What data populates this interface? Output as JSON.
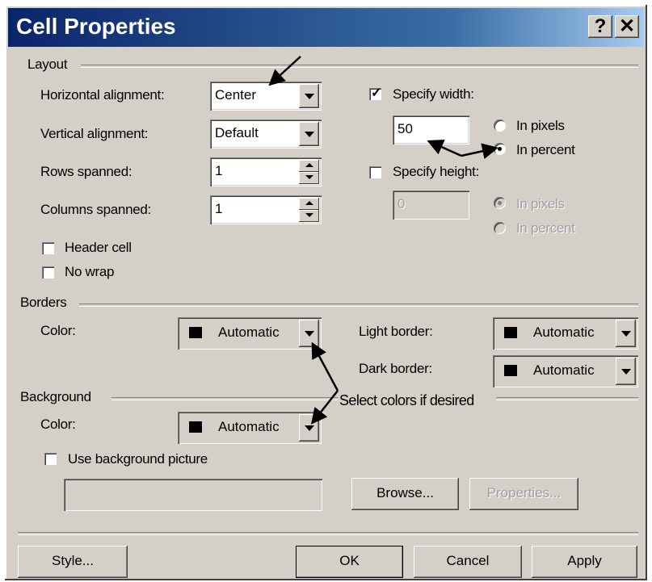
{
  "window": {
    "title": "Cell Properties",
    "help_label": "?",
    "close_label": "✕",
    "accent_color": "#0a246a"
  },
  "layout": {
    "group_label": "Layout",
    "horizontal_alignment": {
      "label": "Horizontal alignment:",
      "value": "Center"
    },
    "vertical_alignment": {
      "label": "Vertical alignment:",
      "value": "Default"
    },
    "rows_spanned": {
      "label": "Rows spanned:",
      "value": "1"
    },
    "columns_spanned": {
      "label": "Columns spanned:",
      "value": "1"
    },
    "header_cell": {
      "label": "Header cell",
      "checked": false
    },
    "no_wrap": {
      "label": "No wrap",
      "checked": false
    },
    "specify_width": {
      "label": "Specify width:",
      "checked": true,
      "value": "50",
      "in_pixels_label": "In pixels",
      "in_percent_label": "In percent",
      "selected": "In percent"
    },
    "specify_height": {
      "label": "Specify height:",
      "checked": false,
      "value": "0",
      "in_pixels_label": "In pixels",
      "in_percent_label": "In percent",
      "selected": "In pixels"
    }
  },
  "borders": {
    "group_label": "Borders",
    "color_label": "Color:",
    "color_value": "Automatic",
    "light_border_label": "Light border:",
    "light_border_value": "Automatic",
    "dark_border_label": "Dark border:",
    "dark_border_value": "Automatic"
  },
  "background": {
    "group_label": "Background",
    "color_label": "Color:",
    "color_value": "Automatic",
    "use_picture_label": "Use background picture",
    "use_picture_checked": false,
    "picture_path": "",
    "browse_label": "Browse...",
    "properties_label": "Properties..."
  },
  "annotation": {
    "text": "Select colors if desired"
  },
  "footer": {
    "style_label": "Style...",
    "ok_label": "OK",
    "cancel_label": "Cancel",
    "apply_label": "Apply"
  }
}
